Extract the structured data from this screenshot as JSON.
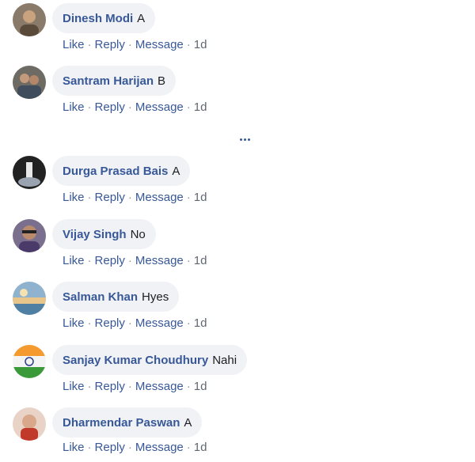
{
  "actions": {
    "like": "Like",
    "reply": "Reply",
    "message": "Message",
    "separator": "·"
  },
  "more_icon": "more-dots-icon",
  "comments": [
    {
      "author": "Dinesh Modi",
      "text": "A",
      "time": "1d"
    },
    {
      "author": "Santram Harijan",
      "text": "B",
      "time": "1d"
    },
    {
      "author": "Durga Prasad Bais",
      "text": "A",
      "time": "1d"
    },
    {
      "author": "Vijay Singh",
      "text": "No",
      "time": "1d"
    },
    {
      "author": "Salman Khan",
      "text": "Hyes",
      "time": "1d"
    },
    {
      "author": "Sanjay Kumar Choudhury",
      "text": "Nahi",
      "time": "1d"
    },
    {
      "author": "Dharmendar Paswan",
      "text": "A",
      "time": "1d"
    }
  ]
}
